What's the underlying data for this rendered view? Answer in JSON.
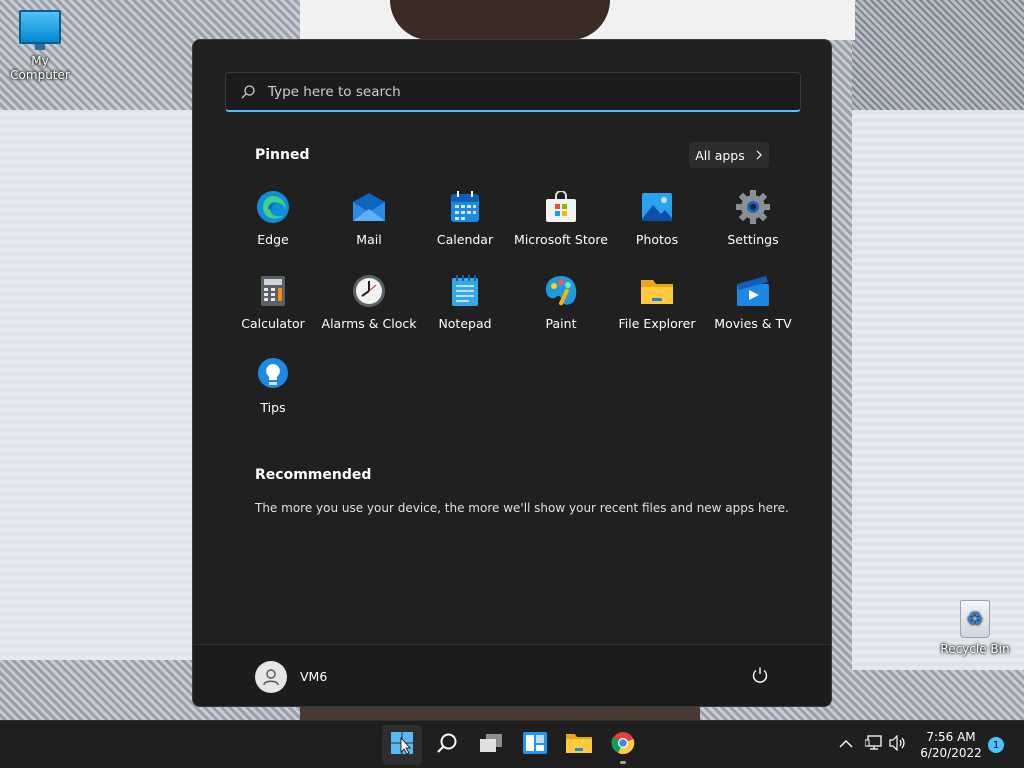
{
  "desktop": {
    "icons": [
      {
        "label": "My Computer",
        "icon": "computer-icon"
      },
      {
        "label": "Recycle Bin",
        "icon": "recycle-bin-icon"
      }
    ]
  },
  "start_menu": {
    "search": {
      "placeholder": "Type here to search"
    },
    "pinned": {
      "title": "Pinned",
      "all_apps_label": "All apps",
      "apps": [
        {
          "label": "Edge",
          "icon": "edge-icon"
        },
        {
          "label": "Mail",
          "icon": "mail-icon"
        },
        {
          "label": "Calendar",
          "icon": "calendar-icon"
        },
        {
          "label": "Microsoft Store",
          "icon": "store-icon"
        },
        {
          "label": "Photos",
          "icon": "photos-icon"
        },
        {
          "label": "Settings",
          "icon": "gear-icon"
        },
        {
          "label": "Calculator",
          "icon": "calculator-icon"
        },
        {
          "label": "Alarms & Clock",
          "icon": "clock-icon"
        },
        {
          "label": "Notepad",
          "icon": "notepad-icon"
        },
        {
          "label": "Paint",
          "icon": "paint-icon"
        },
        {
          "label": "File Explorer",
          "icon": "folder-icon"
        },
        {
          "label": "Movies & TV",
          "icon": "movies-icon"
        },
        {
          "label": "Tips",
          "icon": "tips-icon"
        }
      ]
    },
    "recommended": {
      "title": "Recommended",
      "message": "The more you use your device, the more we'll show your recent files and new apps here."
    },
    "user": {
      "name": "VM6"
    }
  },
  "taskbar": {
    "items": [
      {
        "name": "start",
        "icon": "windows-icon"
      },
      {
        "name": "search",
        "icon": "search-icon"
      },
      {
        "name": "task-view",
        "icon": "task-view-icon"
      },
      {
        "name": "widgets",
        "icon": "widgets-icon"
      },
      {
        "name": "file-explorer",
        "icon": "folder-icon"
      },
      {
        "name": "chrome",
        "icon": "chrome-icon"
      }
    ],
    "tray": {
      "time": "7:56 AM",
      "date": "6/20/2022",
      "notification_count": "1"
    }
  },
  "colors": {
    "accent": "#4cc2ff",
    "menu_bg": "#202020",
    "taskbar_bg": "#1f1f1f"
  }
}
